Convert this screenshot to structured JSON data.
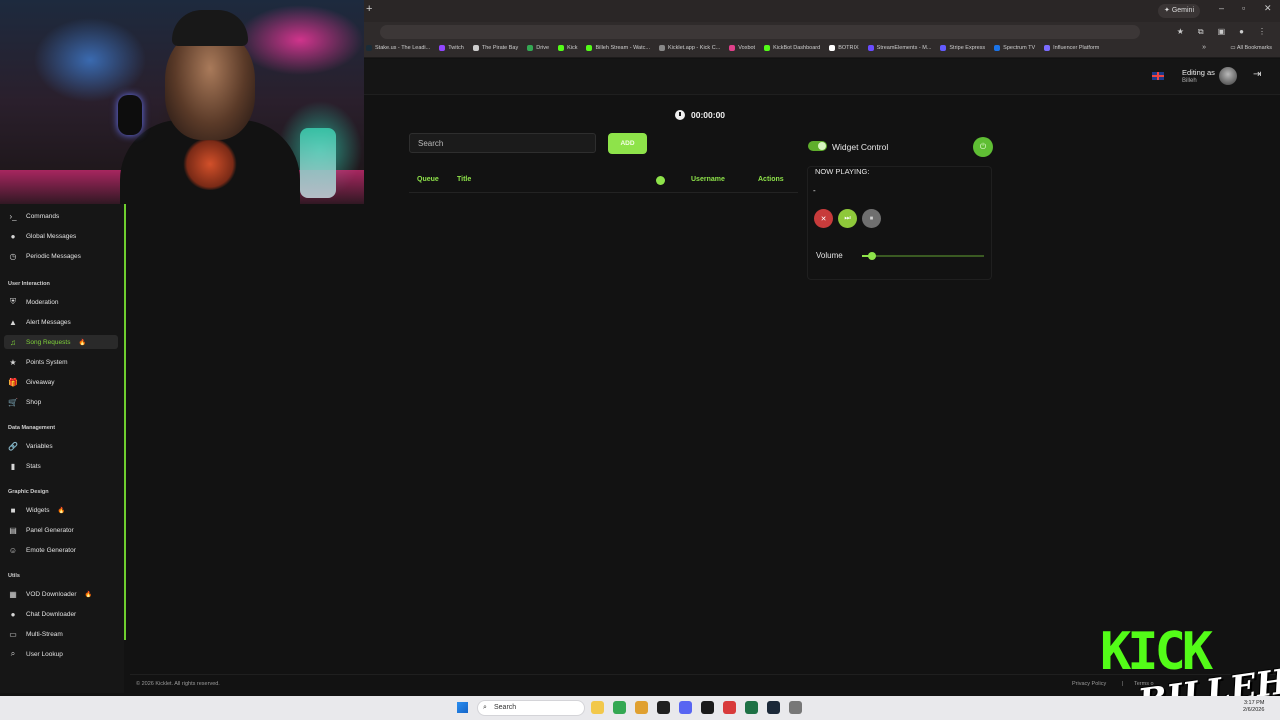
{
  "browser": {
    "new_tab_glyph": "+",
    "gemini_label": "✦ Gemini",
    "window_controls": [
      "–",
      "▫",
      "✕"
    ],
    "bookmarks_more": "»",
    "bookmarks": [
      {
        "label": "Stake.us - The Leadi...",
        "color": "#1a2c38"
      },
      {
        "label": "Twitch",
        "color": "#9146ff"
      },
      {
        "label": "The Pirate Bay",
        "color": "#cccccc"
      },
      {
        "label": "Drive",
        "color": "#34a853"
      },
      {
        "label": "Kick",
        "color": "#53fc18"
      },
      {
        "label": "Billeh Stream - Watc...",
        "color": "#53fc18"
      },
      {
        "label": "Kicklet.app - Kick C...",
        "color": "#888888"
      },
      {
        "label": "Voxbot",
        "color": "#e0408a"
      },
      {
        "label": "KickBot Dashboard",
        "color": "#53fc18"
      },
      {
        "label": "BOTRIX",
        "color": "#ffffff"
      },
      {
        "label": "StreamElements - M...",
        "color": "#6a4cff"
      },
      {
        "label": "Stripe Express",
        "color": "#635bff"
      },
      {
        "label": "Spectrum TV",
        "color": "#1a73e8"
      },
      {
        "label": "Influencer Platform",
        "color": "#7b6cff"
      }
    ],
    "all_bookmarks_label": "All Bookmarks"
  },
  "header": {
    "editing_as_label": "Editing as",
    "editing_user": "Billeh"
  },
  "sidebar": {
    "items_top": [
      {
        "label": "Commands",
        "icon": "terminal-icon",
        "glyph": "›_"
      },
      {
        "label": "Global Messages",
        "icon": "chat-bubble-icon",
        "glyph": "●"
      },
      {
        "label": "Periodic Messages",
        "icon": "clock-icon",
        "glyph": "◷"
      }
    ],
    "sections": [
      {
        "title": "User Interaction",
        "items": [
          {
            "label": "Moderation",
            "icon": "shield-icon",
            "glyph": "⛨",
            "badge": ""
          },
          {
            "label": "Alert Messages",
            "icon": "warning-icon",
            "glyph": "▲",
            "badge": ""
          },
          {
            "label": "Song Requests",
            "icon": "music-note-icon",
            "glyph": "♫",
            "badge": "🔥",
            "active": true
          },
          {
            "label": "Points System",
            "icon": "star-icon",
            "glyph": "★",
            "badge": ""
          },
          {
            "label": "Giveaway",
            "icon": "gift-icon",
            "glyph": "🎁",
            "badge": ""
          },
          {
            "label": "Shop",
            "icon": "cart-icon",
            "glyph": "🛒",
            "badge": ""
          }
        ]
      },
      {
        "title": "Data Management",
        "items": [
          {
            "label": "Variables",
            "icon": "link-icon",
            "glyph": "🔗",
            "badge": ""
          },
          {
            "label": "Stats",
            "icon": "bar-chart-icon",
            "glyph": "▮",
            "badge": ""
          }
        ]
      },
      {
        "title": "Graphic Design",
        "items": [
          {
            "label": "Widgets",
            "icon": "video-icon",
            "glyph": "■",
            "badge": "🔥"
          },
          {
            "label": "Panel Generator",
            "icon": "panel-icon",
            "glyph": "▤",
            "badge": ""
          },
          {
            "label": "Emote Generator",
            "icon": "smiley-icon",
            "glyph": "☺",
            "badge": ""
          }
        ]
      },
      {
        "title": "Utils",
        "items": [
          {
            "label": "VOD Downloader",
            "icon": "film-icon",
            "glyph": "▦",
            "badge": "🔥"
          },
          {
            "label": "Chat Downloader",
            "icon": "chat-bubble-icon",
            "glyph": "●",
            "badge": ""
          },
          {
            "label": "Multi-Stream",
            "icon": "monitor-icon",
            "glyph": "▭",
            "badge": ""
          },
          {
            "label": "User Lookup",
            "icon": "search-icon",
            "glyph": "⌕",
            "badge": ""
          }
        ]
      }
    ]
  },
  "main": {
    "timer": "00:00:00",
    "search_placeholder": "Search",
    "add_label": "ADD",
    "queue_columns": {
      "queue": "Queue",
      "title": "Title",
      "username": "Username",
      "actions": "Actions"
    }
  },
  "widget": {
    "control_label": "Widget Control",
    "now_playing_label": "NOW PLAYING:",
    "current_track": "-",
    "volume_label": "Volume",
    "volume_level": 0.08,
    "power_glyph": "⏻",
    "stop_glyph": "✕",
    "skip_glyph": "⏭",
    "pause_glyph": "⏸"
  },
  "footer": {
    "copyright": "© 2026 Kicklet. All rights reserved.",
    "privacy": "Privacy Policy",
    "separator": "|",
    "terms": "Terms o"
  },
  "overlay": {
    "kick_text": "KICK",
    "signature": "BILLEH"
  },
  "taskbar": {
    "search_label": "Search",
    "time": "3:17 PM",
    "date": "2/6/2026",
    "icons": [
      {
        "name": "file-explorer-icon",
        "color": "#f2c84b"
      },
      {
        "name": "chrome-icon",
        "color": "#34a853"
      },
      {
        "name": "app-icon-1",
        "color": "#e0a030"
      },
      {
        "name": "app-icon-2",
        "color": "#202020"
      },
      {
        "name": "discord-icon",
        "color": "#5865f2"
      },
      {
        "name": "app-icon-3",
        "color": "#1b1b1b"
      },
      {
        "name": "app-icon-4",
        "color": "#d83b3b"
      },
      {
        "name": "excel-icon",
        "color": "#1e7145"
      },
      {
        "name": "steam-icon",
        "color": "#1b2838"
      },
      {
        "name": "settings-icon",
        "color": "#777777"
      }
    ]
  }
}
